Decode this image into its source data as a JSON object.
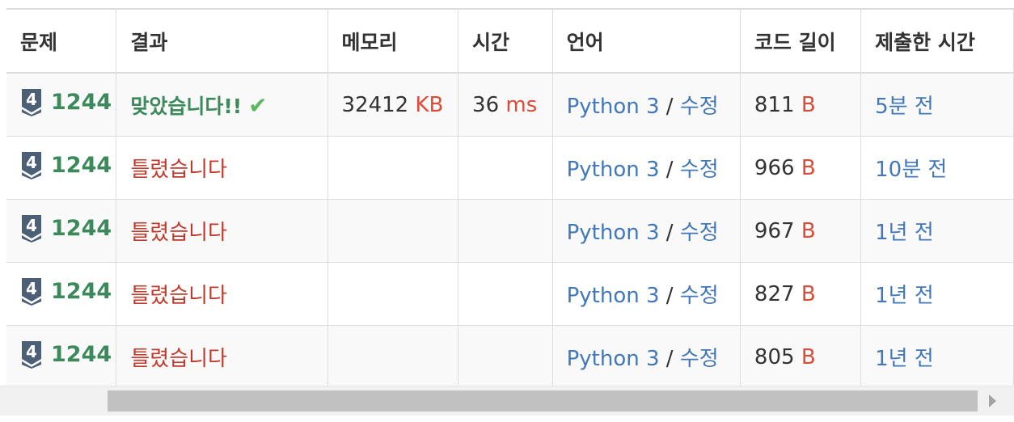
{
  "table": {
    "headers": [
      "문제",
      "결과",
      "메모리",
      "시간",
      "언어",
      "코드 길이",
      "제출한 시간"
    ],
    "rows": [
      {
        "tier": "4",
        "problem_id": "1244",
        "result": "맞았습니다!!",
        "result_type": "accepted",
        "memory_value": "32412",
        "memory_unit": "KB",
        "time_value": "36",
        "time_unit": "ms",
        "language": "Python 3",
        "slash": "/",
        "edit": "수정",
        "length_value": "811",
        "length_unit": "B",
        "submitted": "5분 전"
      },
      {
        "tier": "4",
        "problem_id": "1244",
        "result": "틀렸습니다",
        "result_type": "wrong",
        "memory_value": "",
        "memory_unit": "",
        "time_value": "",
        "time_unit": "",
        "language": "Python 3",
        "slash": "/",
        "edit": "수정",
        "length_value": "966",
        "length_unit": "B",
        "submitted": "10분 전"
      },
      {
        "tier": "4",
        "problem_id": "1244",
        "result": "틀렸습니다",
        "result_type": "wrong",
        "memory_value": "",
        "memory_unit": "",
        "time_value": "",
        "time_unit": "",
        "language": "Python 3",
        "slash": "/",
        "edit": "수정",
        "length_value": "967",
        "length_unit": "B",
        "submitted": "1년 전"
      },
      {
        "tier": "4",
        "problem_id": "1244",
        "result": "틀렸습니다",
        "result_type": "wrong",
        "memory_value": "",
        "memory_unit": "",
        "time_value": "",
        "time_unit": "",
        "language": "Python 3",
        "slash": "/",
        "edit": "수정",
        "length_value": "827",
        "length_unit": "B",
        "submitted": "1년 전"
      },
      {
        "tier": "4",
        "problem_id": "1244",
        "result": "틀렸습니다",
        "result_type": "wrong",
        "memory_value": "",
        "memory_unit": "",
        "time_value": "",
        "time_unit": "",
        "language": "Python 3",
        "slash": "/",
        "edit": "수정",
        "length_value": "805",
        "length_unit": "B",
        "submitted": "1년 전"
      }
    ]
  },
  "colors": {
    "tier_badge": "#4b5f77",
    "problem_link": "#3c8a5b",
    "accepted": "#3c8a5b",
    "check": "#5cb85c",
    "wrong": "#c0392b",
    "unit": "#dd4b39",
    "link": "#4378b8"
  },
  "icons": {
    "tier": "tier-shield-icon",
    "check": "checkmark-icon",
    "scroll_right": "scroll-right-arrow-icon"
  },
  "scrollbar": {
    "position_fraction": 0.11,
    "visible_fraction": 0.89
  }
}
